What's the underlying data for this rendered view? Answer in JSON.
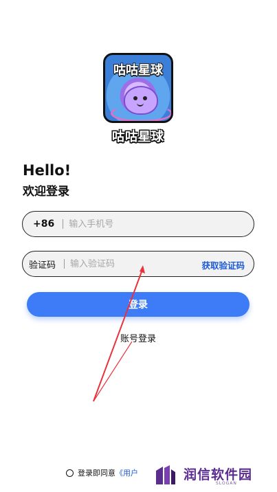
{
  "app": {
    "logo_title": "咕咕星球",
    "brand": "咕咕星球"
  },
  "greeting": {
    "hello": "Hello!",
    "welcome": "欢迎登录"
  },
  "phone_field": {
    "prefix": "+86",
    "placeholder": "输入手机号"
  },
  "code_field": {
    "label": "验证码",
    "placeholder": "输入验证码",
    "get_code": "获取验证码"
  },
  "login_button": "登录",
  "account_login": "账号登录",
  "agreement": {
    "text": "登录即同意",
    "link": "《用户"
  },
  "watermark": {
    "name": "润信软件园",
    "slogan": "SLOGAN"
  },
  "colors": {
    "accent": "#3e7cf7",
    "link": "#1e5bd6",
    "annotation": "#e8323c",
    "watermark": "#5b2d91"
  }
}
